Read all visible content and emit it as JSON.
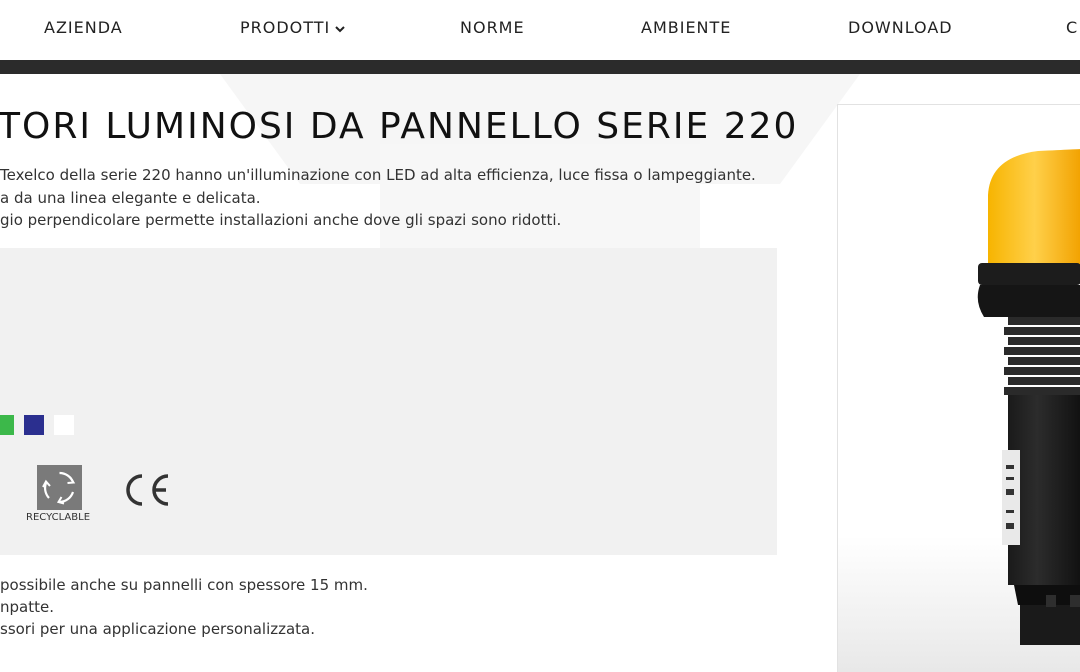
{
  "nav": {
    "items": [
      {
        "label": "AZIENDA"
      },
      {
        "label": "PRODOTTI"
      },
      {
        "label": "NORME"
      },
      {
        "label": "AMBIENTE"
      },
      {
        "label": "DOWNLOAD"
      },
      {
        "label": "C"
      }
    ]
  },
  "main": {
    "title": "TORI LUMINOSI DA PANNELLO SERIE 220",
    "intro": [
      "Texelco della serie 220 hanno un'illuminazione con LED ad alta efficienza, luce fissa o lampeggiante.",
      "a da una linea elegante e delicata.",
      "gio perpendicolare permette installazioni anche dove gli spazi sono ridotti."
    ],
    "color_swatches": [
      "#3cb84a",
      "#2b2f8f",
      "#ffffff"
    ],
    "badges": {
      "recyclable_label": "RECYCLABLE",
      "ce_mark": "CE"
    },
    "details": [
      "possibile anche su pannelli con spessore 15 mm.",
      "npatte.",
      "ssori per una applicazione personalizzata."
    ]
  },
  "colors": {
    "nav_bar": "#2b2b2b",
    "panel_bg": "#f1f1f1",
    "lens": "#f5a800"
  },
  "icons": [
    "chevron-down-icon",
    "recycle-icon",
    "ce-mark-icon"
  ]
}
